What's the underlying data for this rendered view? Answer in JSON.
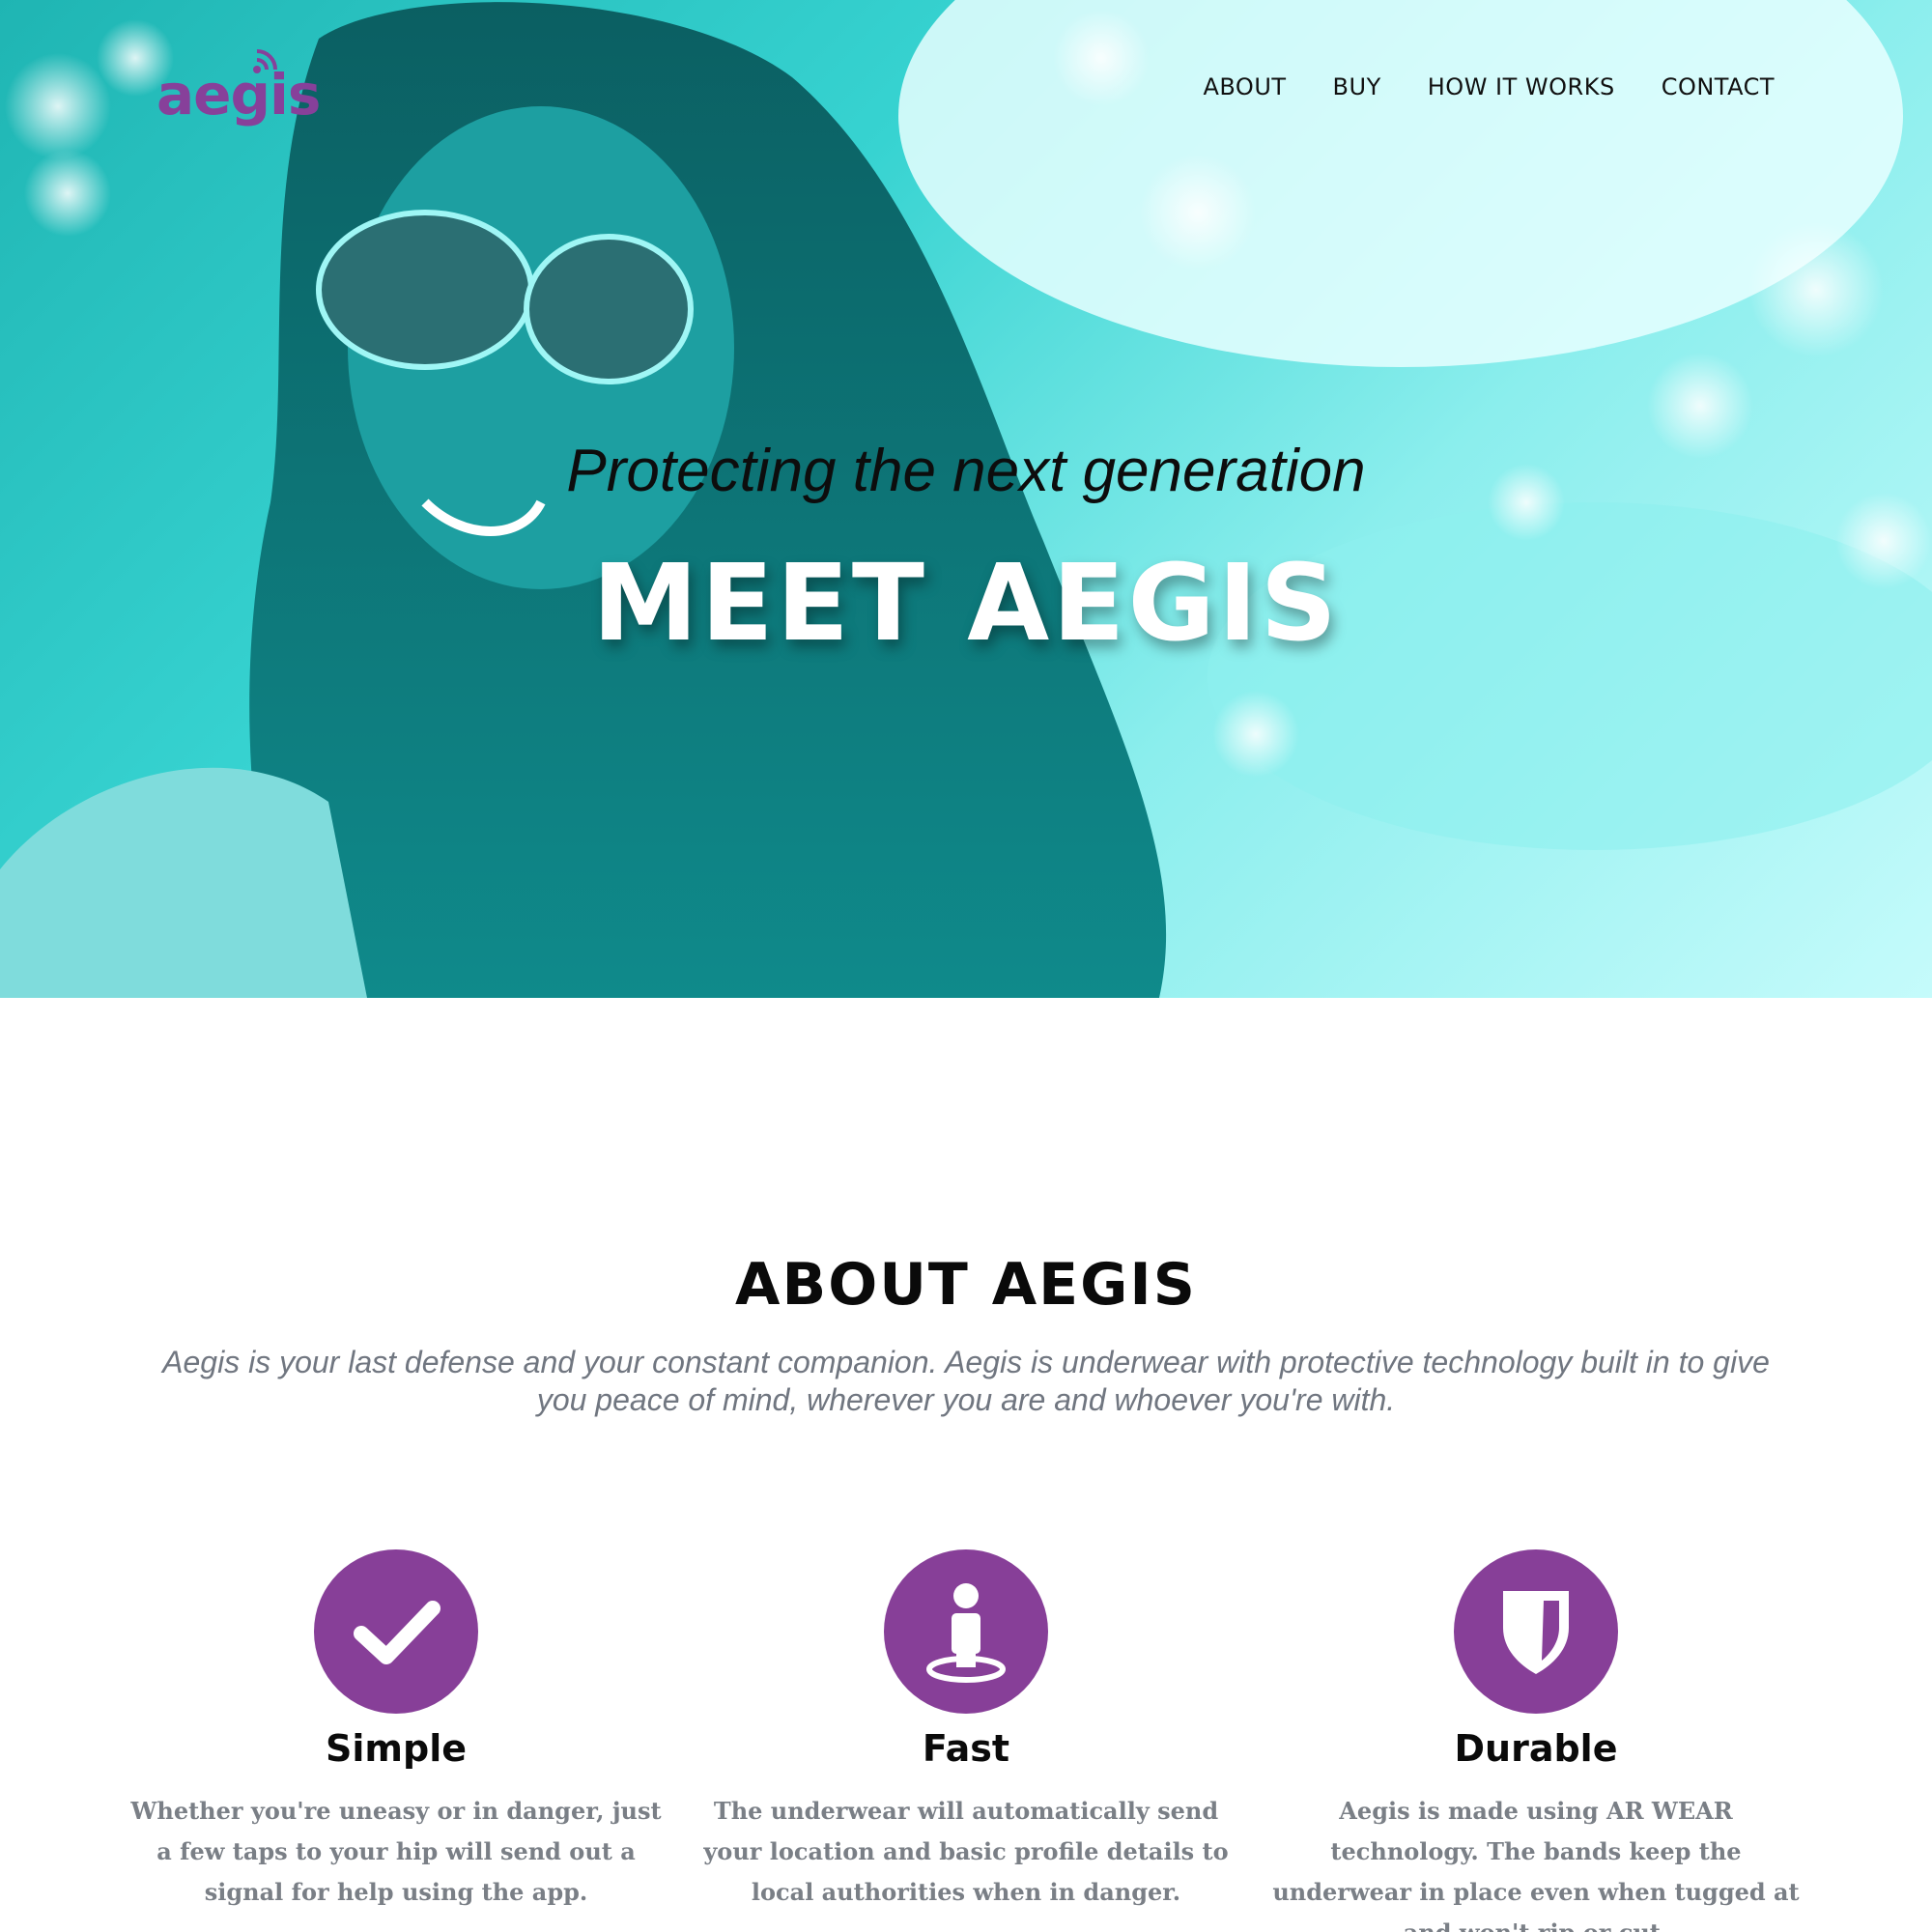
{
  "brand": {
    "logo_text": "aegis",
    "logo_color": "#87409a"
  },
  "nav": {
    "items": [
      {
        "label": "ABOUT"
      },
      {
        "label": "BUY"
      },
      {
        "label": "HOW IT WORKS"
      },
      {
        "label": "CONTACT"
      }
    ]
  },
  "hero": {
    "tagline": "Protecting the next generation",
    "title": "MEET AEGIS",
    "tint_color": "#37d3d1"
  },
  "about": {
    "heading": "ABOUT AEGIS",
    "description": "Aegis is your last defense and your constant companion. Aegis is underwear with protective technology built in to give you peace of mind, wherever you are and whoever you're with.",
    "features": [
      {
        "icon": "checkmark-icon",
        "title": "Simple",
        "text": "Whether you're uneasy or in danger, just a few taps to your hip will send out a signal for help using the app."
      },
      {
        "icon": "person-location-icon",
        "title": "Fast",
        "text": "The underwear will automatically send your location and basic profile details to local authorities when in danger."
      },
      {
        "icon": "shield-icon",
        "title": "Durable",
        "text": "Aegis is made using AR WEAR technology. The bands keep the underwear in place even when tugged at and won't rip or cut."
      }
    ],
    "accent_color": "#873f98"
  }
}
